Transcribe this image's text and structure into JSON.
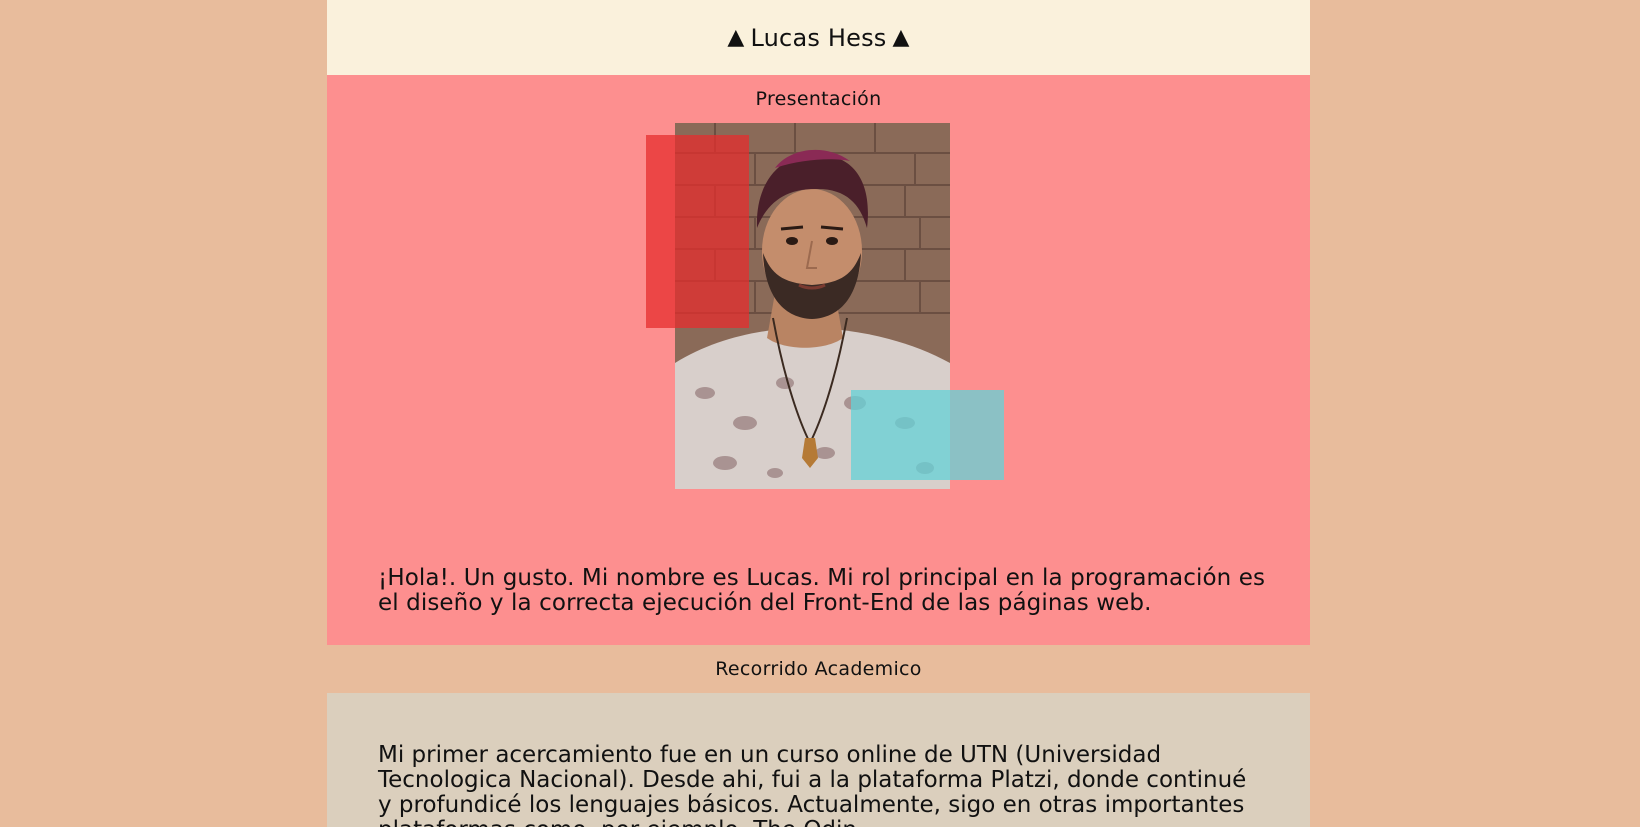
{
  "header": {
    "left_symbol": "▲",
    "name": "Lucas Hess",
    "right_symbol": "▲"
  },
  "presentation": {
    "title": "Presentación",
    "photo_alt": "Lucas Hess portrait",
    "intro": "¡Hola!. Un gusto. Mi nombre es Lucas. Mi rol principal en la programación es el diseño y la correcta ejecución del Front-End de las páginas web."
  },
  "academic": {
    "title": "Recorrido Academico",
    "text": "Mi primer acercamiento fue en un curso online de UTN (Universidad Tecnologica Nacional). Desde ahi, fui a la plataforma Platzi, donde continué y profundicé los lenguajes básicos. Actualmente, sigo en otras importantes plataformas como, por ejemplo, The Odin"
  },
  "colors": {
    "page_bg": "#e8bc9c",
    "header_bg": "#faf1dc",
    "presentation_bg": "#fd8f8f",
    "academic_bg": "#dbcfbd",
    "deco_red": "#e62d2d",
    "deco_blue": "#64d2d7"
  }
}
